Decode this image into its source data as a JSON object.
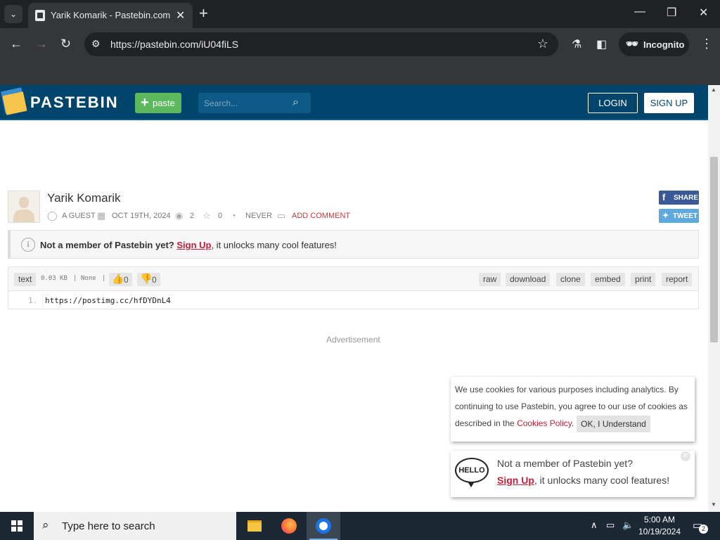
{
  "browser": {
    "tab_title": "Yarik Komarik - Pastebin.com",
    "url": "https://pastebin.com/iU04fiLS",
    "incognito_label": "Incognito"
  },
  "site": {
    "name": "PASTEBIN",
    "paste_button": "paste",
    "search_placeholder": "Search...",
    "login": "LOGIN",
    "signup": "SIGN UP"
  },
  "paste": {
    "title": "Yarik Komarik",
    "author": "A GUEST",
    "date": "OCT 19TH, 2024",
    "views": "2",
    "stars": "0",
    "expires": "NEVER",
    "add_comment": "ADD COMMENT",
    "share": "SHARE",
    "tweet": "TWEET"
  },
  "notice": {
    "bold": "Not a member of Pastebin yet?",
    "link": "Sign Up",
    "rest": ", it unlocks many cool features!"
  },
  "code": {
    "syntax": "text",
    "size": "0.03 KB",
    "sep1": "|",
    "category": "None",
    "sep2": "|",
    "likes": "0",
    "dislikes": "0",
    "actions": [
      "raw",
      "download",
      "clone",
      "embed",
      "print",
      "report"
    ],
    "line_number": "1.",
    "line": "https://postimg.cc/hfDYDnL4"
  },
  "ad_label": "Advertisement",
  "cookie": {
    "text_before": "We use cookies for various purposes including analytics. By continuing to use Pastebin, you agree to our use of cookies as described in the ",
    "link": "Cookies Policy",
    "text_after": ".",
    "ok": "OK, I Understand"
  },
  "hello": {
    "bubble": "HELLO",
    "line1": "Not a member of Pastebin yet?",
    "link": "Sign Up",
    "rest": ", it unlocks many cool features!"
  },
  "taskbar": {
    "search": "Type here to search",
    "time": "5:00 AM",
    "date": "10/19/2024",
    "notifications": "2"
  }
}
